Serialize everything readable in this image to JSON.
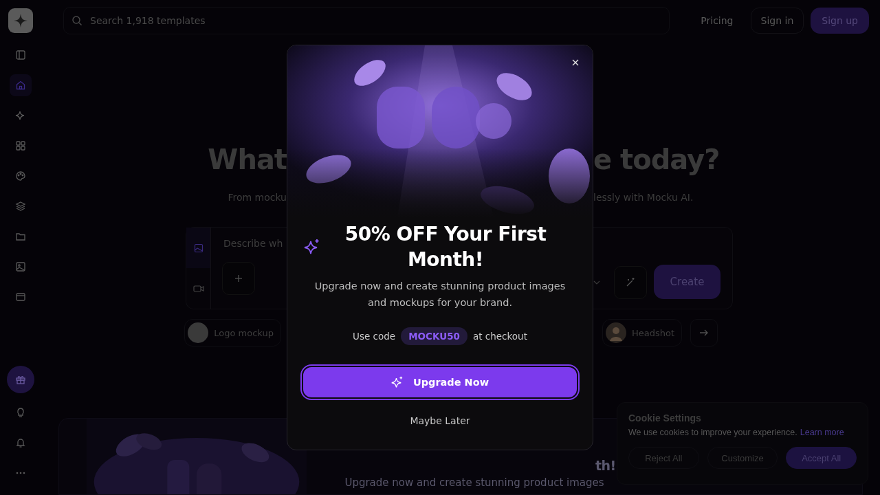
{
  "search": {
    "placeholder": "Search 1,918 templates"
  },
  "nav": [
    {
      "label": "Pricing",
      "kind": "link"
    },
    {
      "label": "Sign in",
      "kind": "outline"
    },
    {
      "label": "Sign up",
      "kind": "primary"
    }
  ],
  "sidebar": {
    "items": [
      {
        "selected": false
      },
      {
        "selected": true
      },
      {
        "selected": false
      },
      {
        "selected": false
      },
      {
        "selected": false
      },
      {
        "selected": false
      },
      {
        "selected": false
      },
      {
        "selected": false
      },
      {
        "selected": false
      }
    ]
  },
  "hero": {
    "title_left": "What",
    "title_right": "e today?",
    "subtitle_left": "From mocku",
    "subtitle_right": "lessly with Mocku AI."
  },
  "prompt": {
    "placeholder": "Describe wh",
    "modes": [
      {
        "selected": true
      },
      {
        "selected": false
      }
    ],
    "create_button": "Create"
  },
  "chips_left": [
    {
      "label": "Logo mockup"
    }
  ],
  "chips_right": [
    {
      "label": "Headshot"
    }
  ],
  "banner": {
    "title_visible": "th!",
    "subtitle": "Upgrade now and create stunning product images"
  },
  "modal": {
    "heading": "50% OFF Your First Month!",
    "body": "Upgrade now and create stunning product images and mockups for your brand.",
    "code_prefix": "Use code",
    "code": "MOCKU50",
    "code_suffix": "at checkout",
    "primary_button": "Upgrade Now",
    "secondary_button": "Maybe Later"
  },
  "cookie": {
    "title": "Cookie Settings",
    "text": "We use cookies to improve your experience.",
    "link": "Learn more",
    "buttons": [
      {
        "label": "Reject All",
        "kind": "outline"
      },
      {
        "label": "Customize",
        "kind": "outline"
      },
      {
        "label": "Accept All",
        "kind": "primary"
      }
    ]
  }
}
